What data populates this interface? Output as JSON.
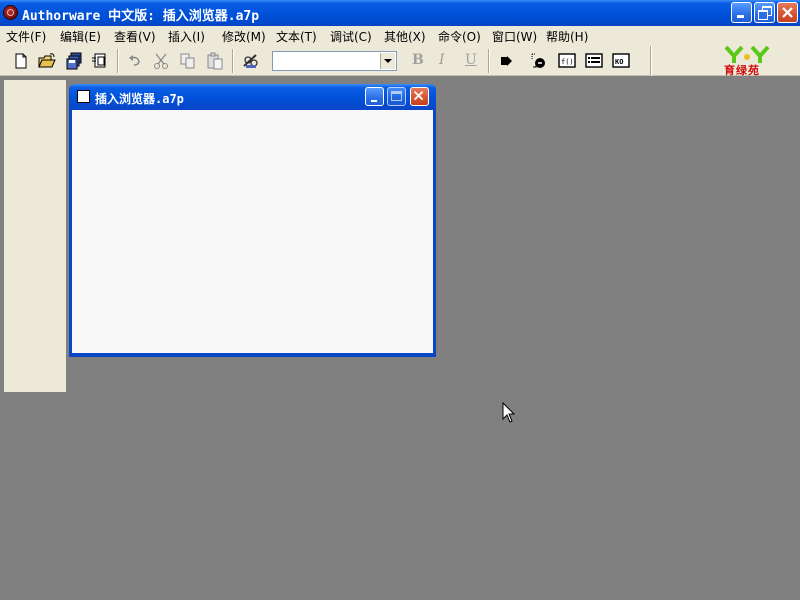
{
  "app": {
    "title": "Authorware 中文版: 插入浏览器.a7p"
  },
  "menu": {
    "items": [
      {
        "label": "文件(F)"
      },
      {
        "label": "编辑(E)"
      },
      {
        "label": "查看(V)"
      },
      {
        "label": "插入(I)"
      },
      {
        "label": "修改(M)"
      },
      {
        "label": "文本(T)"
      },
      {
        "label": "调试(C)"
      },
      {
        "label": "其他(X)"
      },
      {
        "label": "命令(O)"
      },
      {
        "label": "窗口(W)"
      },
      {
        "label": "帮助(H)"
      }
    ]
  },
  "toolbar": {
    "font_combo_value": "",
    "bold_label": "B",
    "italic_label": "I",
    "underline_label": "U",
    "icons": [
      "new-file-icon",
      "open-file-icon",
      "save-all-icon",
      "import-icon",
      "undo-icon",
      "cut-icon",
      "copy-icon",
      "paste-icon",
      "find-icon",
      "run-icon",
      "control-panel-icon",
      "functions-icon",
      "variables-icon",
      "knowledge-objects-icon"
    ]
  },
  "logo": {
    "text": "育绿苑",
    "colors": {
      "letters": "#5cc81a",
      "text": "#d01010"
    }
  },
  "document": {
    "title": "插入浏览器.a7p"
  },
  "colors": {
    "desktop": "#808080",
    "chrome": "#ece9d8",
    "titlebar": "#0052d9",
    "close_button": "#d65431",
    "document_bg": "#f8f8f8"
  }
}
